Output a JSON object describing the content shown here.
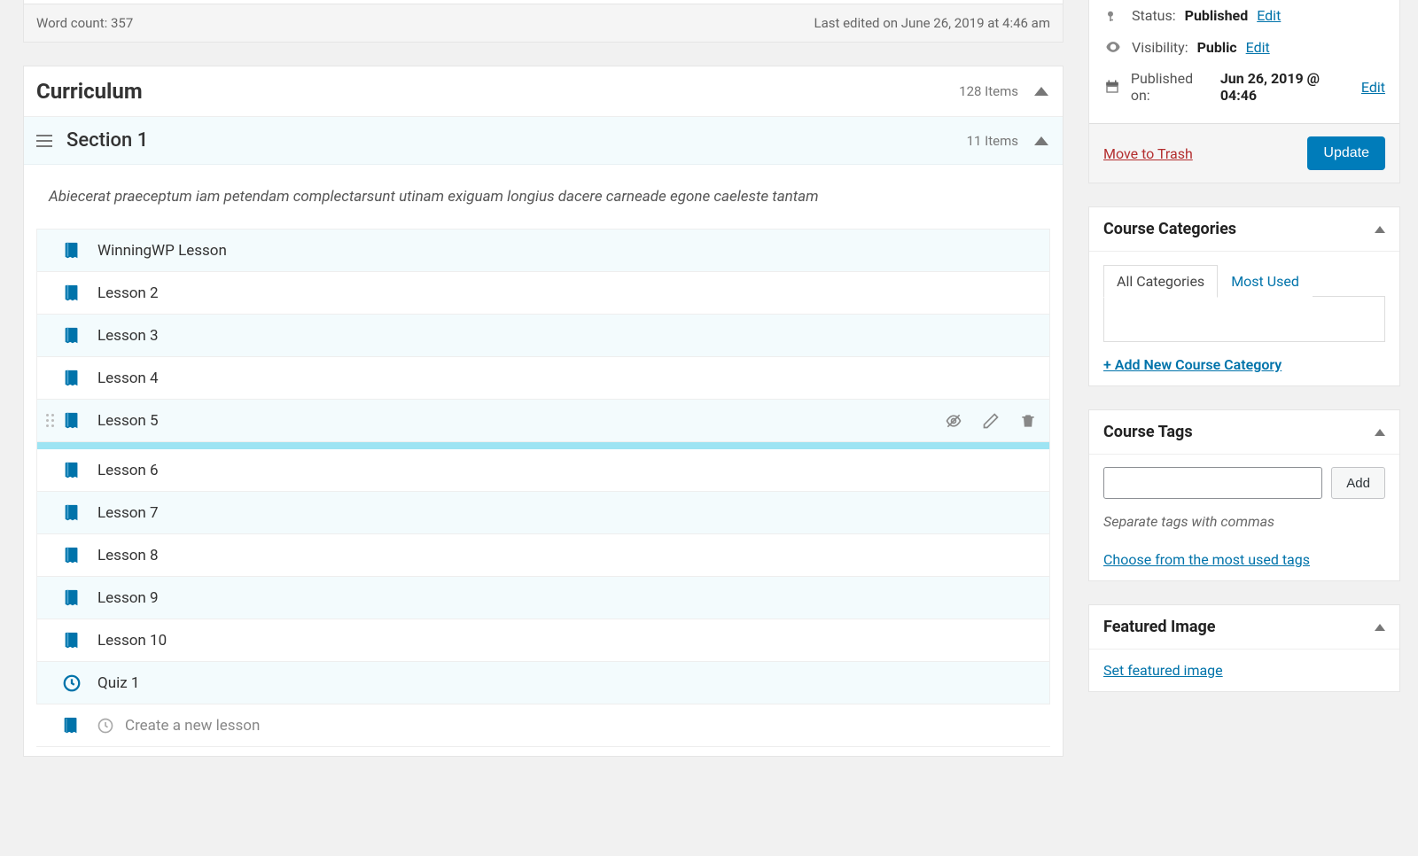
{
  "editor": {
    "word_count": "Word count: 357",
    "last_edited": "Last edited on June 26, 2019 at 4:46 am"
  },
  "curriculum": {
    "title": "Curriculum",
    "items_label": "128 Items",
    "section": {
      "title": "Section 1",
      "items_label": "11 Items",
      "description": "Abiecerat praeceptum iam petendam complectarsunt utinam exiguam longius dacere carneade egone caeleste tantam",
      "hovered_index": 4,
      "lessons": [
        {
          "title": "WinningWP Lesson",
          "type": "lesson"
        },
        {
          "title": "Lesson 2",
          "type": "lesson"
        },
        {
          "title": "Lesson 3",
          "type": "lesson"
        },
        {
          "title": "Lesson 4",
          "type": "lesson"
        },
        {
          "title": "Lesson 5",
          "type": "lesson"
        },
        {
          "title": "Lesson 6",
          "type": "lesson"
        },
        {
          "title": "Lesson 7",
          "type": "lesson"
        },
        {
          "title": "Lesson 8",
          "type": "lesson"
        },
        {
          "title": "Lesson 9",
          "type": "lesson"
        },
        {
          "title": "Lesson 10",
          "type": "lesson"
        },
        {
          "title": "Quiz 1",
          "type": "quiz"
        }
      ],
      "create_placeholder": "Create a new lesson"
    }
  },
  "publish": {
    "status_label": "Status:",
    "status_value": "Published",
    "status_edit": "Edit",
    "visibility_label": "Visibility:",
    "visibility_value": "Public",
    "visibility_edit": "Edit",
    "published_label": "Published on:",
    "published_value": "Jun 26, 2019 @ 04:46",
    "published_edit": "Edit",
    "trash": "Move to Trash",
    "update": "Update"
  },
  "categories": {
    "title": "Course Categories",
    "tab_all": "All Categories",
    "tab_most": "Most Used",
    "add_new": "+ Add New Course Category"
  },
  "tags": {
    "title": "Course Tags",
    "add_btn": "Add",
    "hint": "Separate tags with commas",
    "choose": "Choose from the most used tags"
  },
  "featured": {
    "title": "Featured Image",
    "set_link": "Set featured image"
  }
}
